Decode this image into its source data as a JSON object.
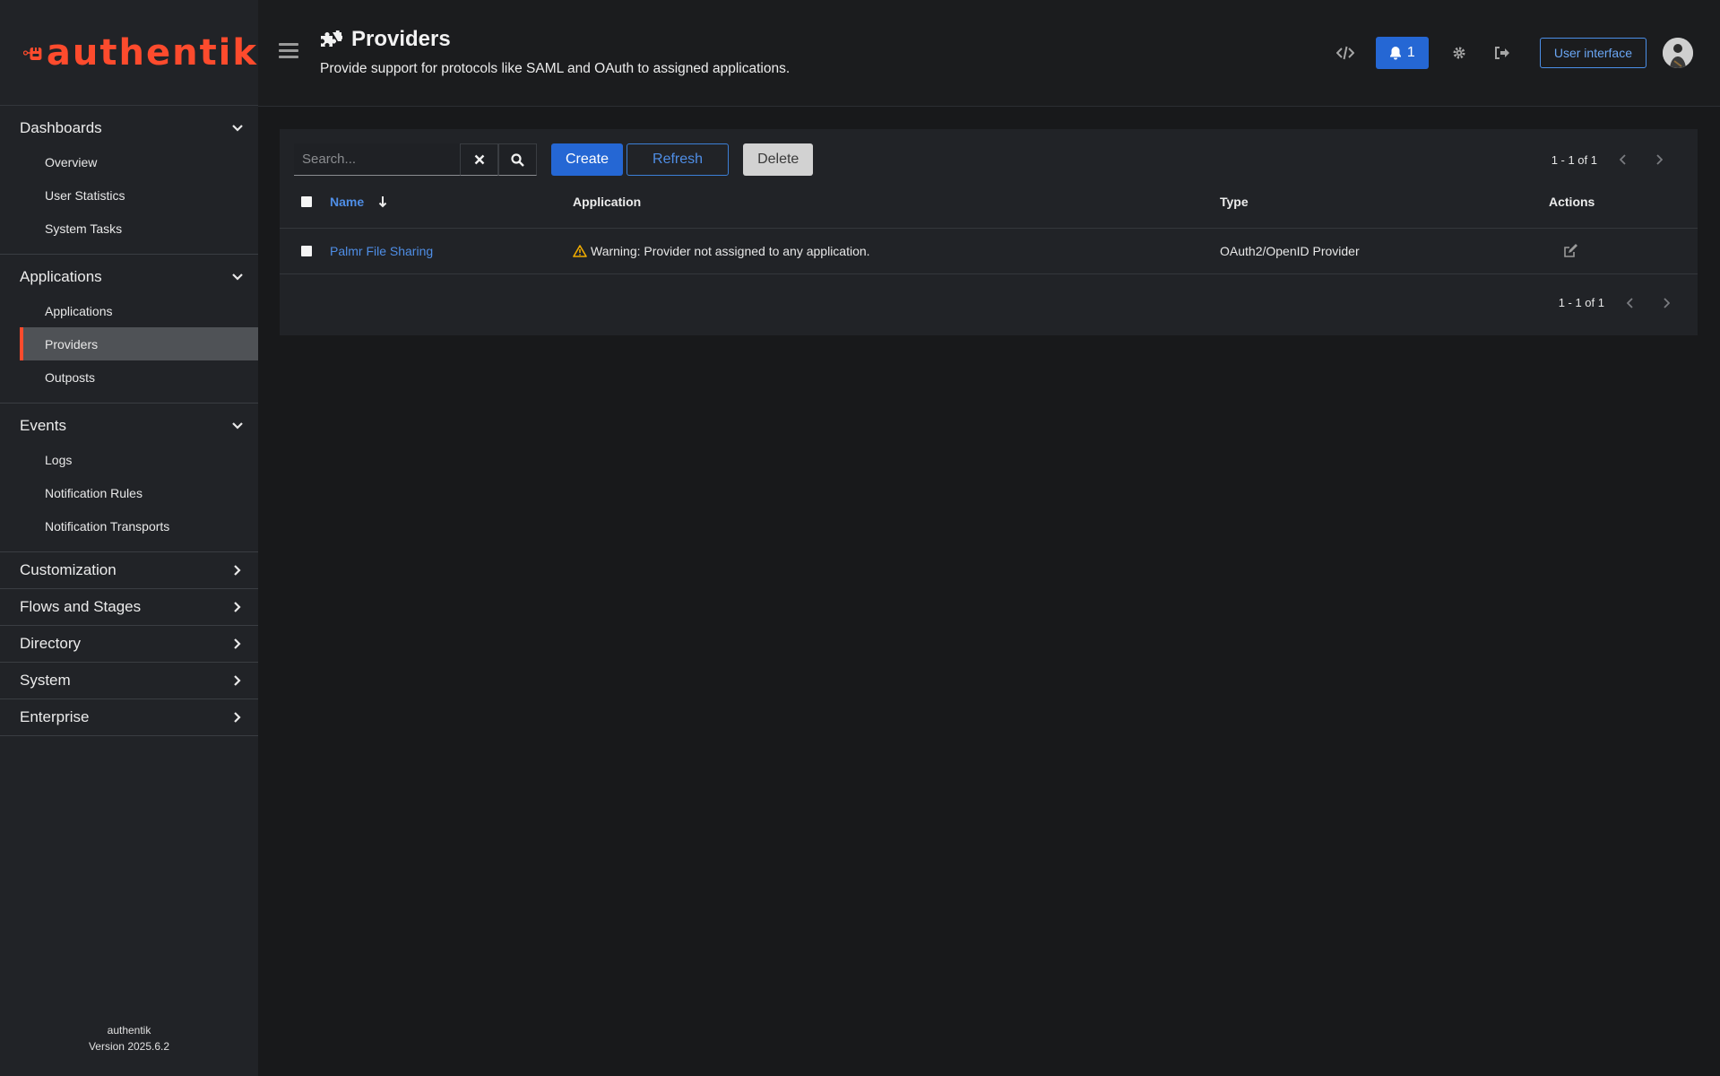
{
  "app": {
    "logo_text": "authentik",
    "version_name": "authentik",
    "version_label": "Version 2025.6.2"
  },
  "colors": {
    "brand": "#fd4b2d",
    "primary": "#2567d4",
    "link": "#4f8ee6",
    "warning": "#f0ab00"
  },
  "sidebar": {
    "groups": [
      {
        "label": "Dashboards",
        "expanded": true,
        "items": [
          "Overview",
          "User Statistics",
          "System Tasks"
        ]
      },
      {
        "label": "Applications",
        "expanded": true,
        "items": [
          "Applications",
          "Providers",
          "Outposts"
        ],
        "active": "Providers"
      },
      {
        "label": "Events",
        "expanded": true,
        "items": [
          "Logs",
          "Notification Rules",
          "Notification Transports"
        ]
      },
      {
        "label": "Customization",
        "expanded": false
      },
      {
        "label": "Flows and Stages",
        "expanded": false
      },
      {
        "label": "Directory",
        "expanded": false
      },
      {
        "label": "System",
        "expanded": false
      },
      {
        "label": "Enterprise",
        "expanded": false
      }
    ]
  },
  "header": {
    "title": "Providers",
    "title_icon": "puzzle-icon",
    "description": "Provide support for protocols like SAML and OAuth to assigned applications.",
    "notification_count": "1",
    "user_interface_label": "User interface"
  },
  "toolbar": {
    "search_placeholder": "Search...",
    "create_label": "Create",
    "refresh_label": "Refresh",
    "delete_label": "Delete",
    "pagination": "1 - 1 of 1"
  },
  "table": {
    "columns": {
      "name": "Name",
      "application": "Application",
      "type": "Type",
      "actions": "Actions"
    },
    "rows": [
      {
        "name": "Palmr File Sharing",
        "application": "Warning: Provider not assigned to any application.",
        "type": "OAuth2/OpenID Provider"
      }
    ],
    "pagination": "1 - 1 of 1"
  }
}
